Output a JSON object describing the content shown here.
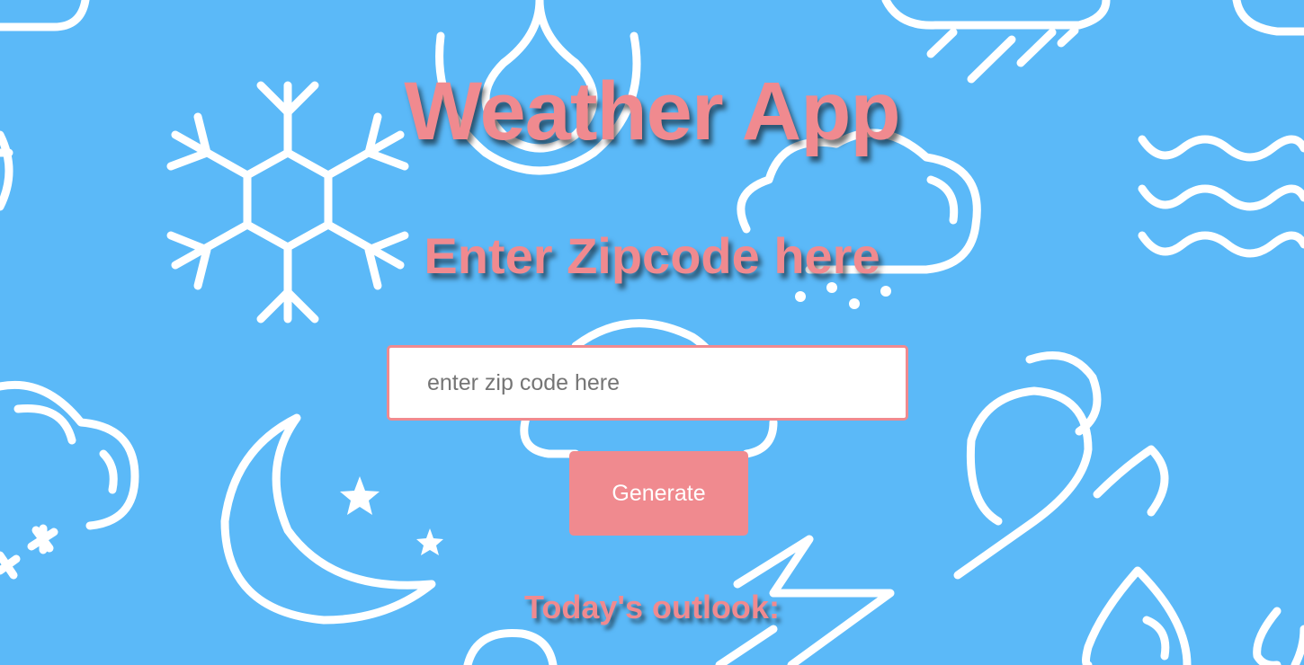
{
  "header": {
    "title": "Weather App",
    "subtitle": "Enter Zipcode here"
  },
  "form": {
    "zip_placeholder": "enter zip code here",
    "zip_value": "",
    "generate_label": "Generate"
  },
  "outlook": {
    "label": "Today's outlook:"
  },
  "background": {
    "color": "#5bb9f8",
    "icons": [
      "snowflake-icon",
      "raindrop-icon",
      "rain-cloud-icon",
      "snow-cloud-icon",
      "waves-icon",
      "moon-icon",
      "star-icon",
      "wind-icon",
      "lightning-icon",
      "cloud-icon"
    ]
  },
  "colors": {
    "accent": "#f08a8f",
    "input_bg": "#ffffff",
    "button_text": "#ffffff"
  }
}
